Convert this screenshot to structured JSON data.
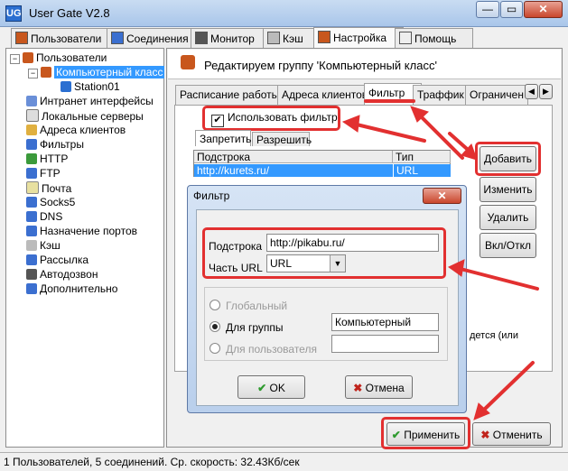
{
  "window": {
    "title": "User Gate V2.8",
    "app_icon": "UG"
  },
  "window_buttons": {
    "minimize": "—",
    "maximize": "▭",
    "close": "✕"
  },
  "main_tabs": [
    {
      "label": "Пользователи",
      "icon": "users-icon"
    },
    {
      "label": "Соединения",
      "icon": "connections-icon"
    },
    {
      "label": "Монитор",
      "icon": "monitor-icon"
    },
    {
      "label": "Кэш",
      "icon": "cache-icon"
    },
    {
      "label": "Настройка",
      "icon": "settings-icon"
    },
    {
      "label": "Помощь",
      "icon": "help-icon"
    }
  ],
  "tree": {
    "items": [
      {
        "label": "Пользователи"
      },
      {
        "label": "Компьютерный класс"
      },
      {
        "label": "Station01"
      },
      {
        "label": "Интранет интерфейсы"
      },
      {
        "label": "Локальные серверы"
      },
      {
        "label": "Адреса клиентов"
      },
      {
        "label": "Фильтры"
      },
      {
        "label": "HTTP"
      },
      {
        "label": "FTP"
      },
      {
        "label": "Почта"
      },
      {
        "label": "Socks5"
      },
      {
        "label": "DNS"
      },
      {
        "label": "Назначение портов"
      },
      {
        "label": "Кэш"
      },
      {
        "label": "Рассылка"
      },
      {
        "label": "Автодозвон"
      },
      {
        "label": "Дополнительно"
      }
    ]
  },
  "header": {
    "title": "Редактируем группу 'Компьютерный класс'"
  },
  "sub_tabs": [
    {
      "label": "Расписание работы"
    },
    {
      "label": "Адреса клиентов"
    },
    {
      "label": "Фильтр"
    },
    {
      "label": "Траффик"
    },
    {
      "label": "Ограничен"
    }
  ],
  "sub_tab_nav": {
    "left": "◀",
    "right": "▶"
  },
  "filter": {
    "use_filter_label": "Использовать фильтр",
    "use_filter_checked": "✔",
    "inner_tabs": [
      "Запретить",
      "Разрешить"
    ],
    "columns": [
      "Подстрока",
      "Тип"
    ],
    "rows": [
      {
        "substring": "http://kurets.ru/",
        "type": "URL"
      }
    ]
  },
  "side_buttons": {
    "add": "Добавить",
    "change": "Изменить",
    "delete": "Удалить",
    "toggle": "Вкл/Откл"
  },
  "hidden_text": "дется (или",
  "dialog": {
    "title": "Фильтр",
    "close": "✕",
    "substring_label": "Подстрока",
    "substring_value": "http://pikabu.ru/",
    "part_label": "Часть URL",
    "part_value": "URL",
    "radio_global": "Глобальный",
    "radio_group": "Для группы",
    "radio_user": "Для пользователя",
    "group_value": "Компьютерный класс",
    "user_value": "",
    "ok": "OK",
    "cancel": "Отмена"
  },
  "bottom": {
    "apply": "Применить",
    "cancel": "Отменить"
  },
  "status": {
    "text": "1 Пользователей, 5 соединений. Ср. скорость: 32.43Кб/сек"
  },
  "colors": {
    "annotation_red": "#e23030",
    "selection": "#3399ff"
  }
}
